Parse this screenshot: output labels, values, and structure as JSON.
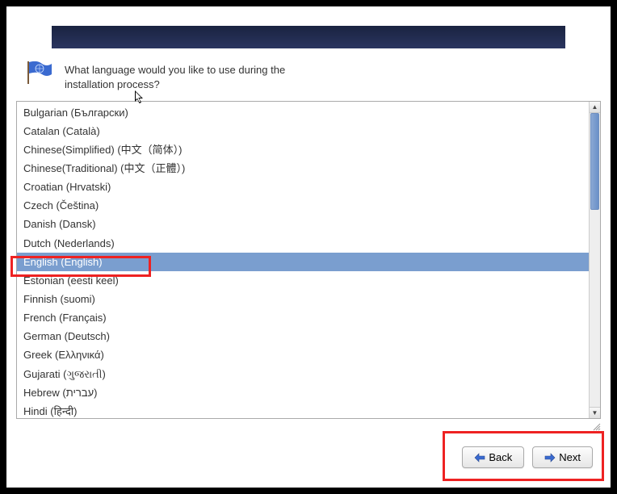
{
  "prompt": {
    "line1": "What language would you like to use during the",
    "line2": "installation process?"
  },
  "languages": [
    {
      "label": "Bulgarian (Български)",
      "selected": false
    },
    {
      "label": "Catalan (Català)",
      "selected": false
    },
    {
      "label": "Chinese(Simplified) (中文（简体）)",
      "selected": false
    },
    {
      "label": "Chinese(Traditional) (中文（正體）)",
      "selected": false
    },
    {
      "label": "Croatian (Hrvatski)",
      "selected": false
    },
    {
      "label": "Czech (Čeština)",
      "selected": false
    },
    {
      "label": "Danish (Dansk)",
      "selected": false
    },
    {
      "label": "Dutch (Nederlands)",
      "selected": false
    },
    {
      "label": "English (English)",
      "selected": true
    },
    {
      "label": "Estonian (eesti keel)",
      "selected": false
    },
    {
      "label": "Finnish (suomi)",
      "selected": false
    },
    {
      "label": "French (Français)",
      "selected": false
    },
    {
      "label": "German (Deutsch)",
      "selected": false
    },
    {
      "label": "Greek (Ελληνικά)",
      "selected": false
    },
    {
      "label": "Gujarati (ગુજરાતી)",
      "selected": false
    },
    {
      "label": "Hebrew (עברית)",
      "selected": false
    },
    {
      "label": "Hindi (हिन्दी)",
      "selected": false
    }
  ],
  "buttons": {
    "back": "Back",
    "next": "Next"
  }
}
